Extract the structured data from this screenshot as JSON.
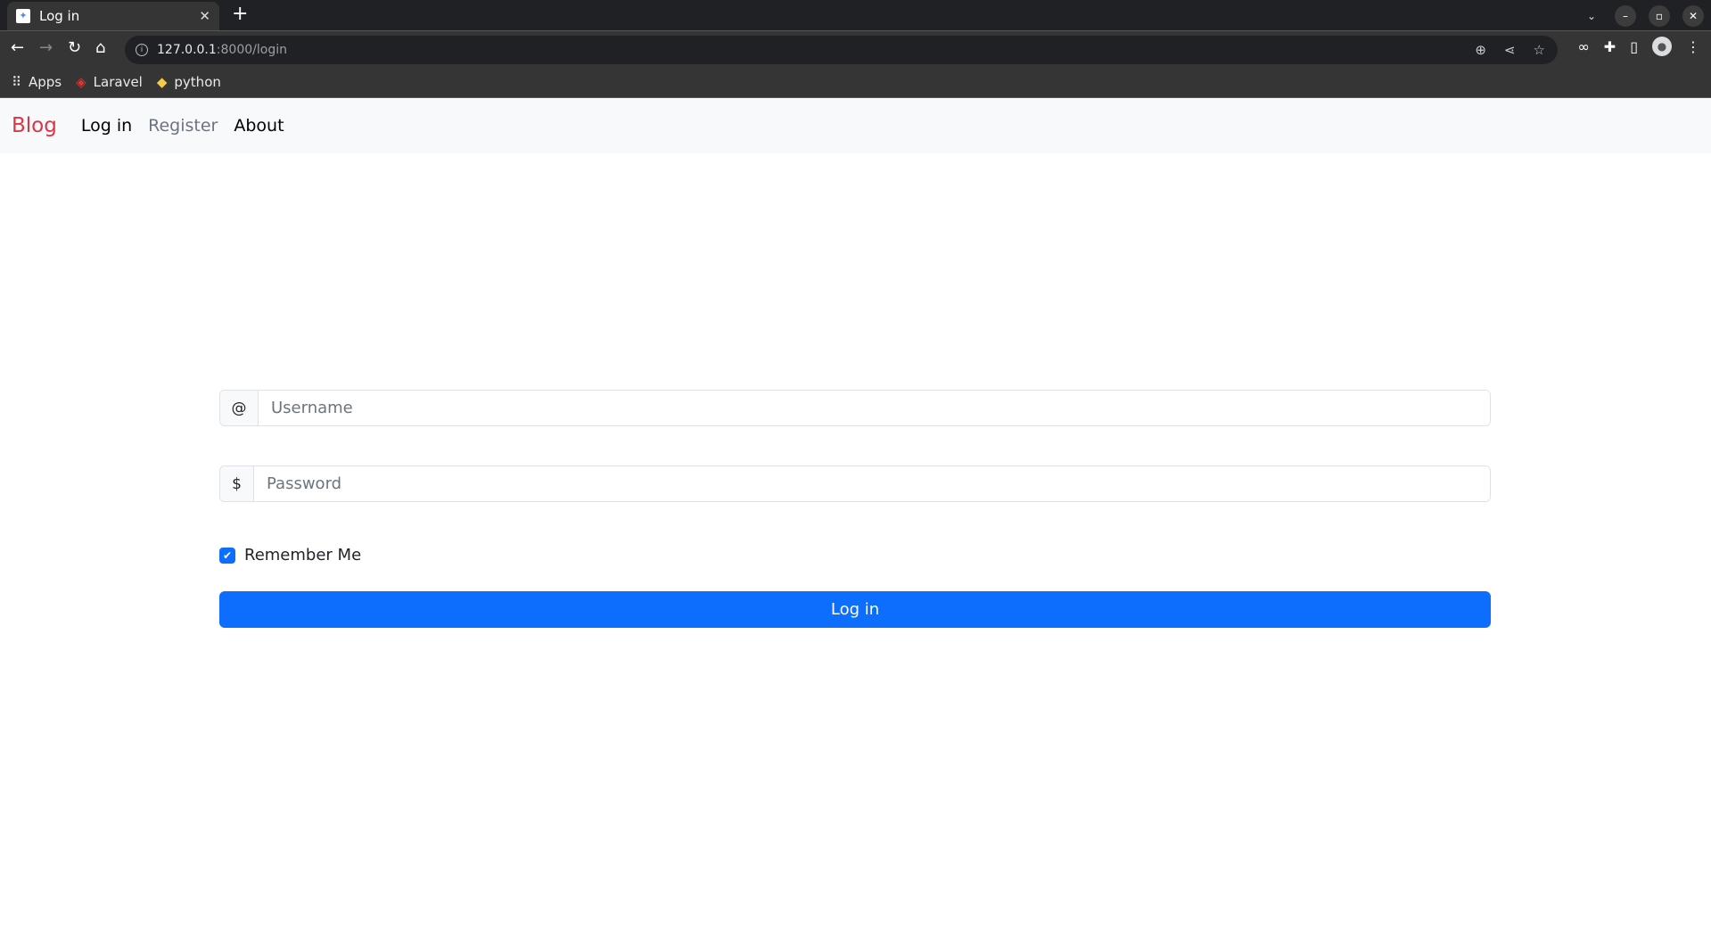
{
  "browser": {
    "tab_title": "Log in",
    "url_host": "127.0.0.1",
    "url_path": ":8000/login",
    "bookmarks": [
      {
        "label": "Apps"
      },
      {
        "label": "Laravel"
      },
      {
        "label": "python"
      }
    ]
  },
  "navbar": {
    "brand": "Blog",
    "links": [
      {
        "label": "Log in"
      },
      {
        "label": "Register"
      },
      {
        "label": "About"
      }
    ]
  },
  "form": {
    "username_prefix": "@",
    "username_placeholder": "Username",
    "username_value": "",
    "password_prefix": "$",
    "password_placeholder": "Password",
    "password_value": "",
    "remember_label": "Remember Me",
    "remember_checked": true,
    "submit_label": "Log in"
  },
  "colors": {
    "brand": "#dc3545",
    "primary": "#0d6efd"
  }
}
